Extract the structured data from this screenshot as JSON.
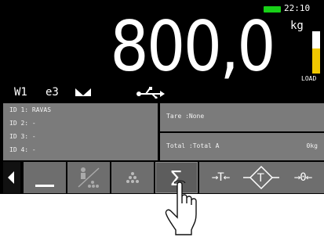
{
  "status_bar": {
    "time": "22:10",
    "battery_color": "#18d018"
  },
  "display": {
    "weight": "800,0",
    "unit": "kg",
    "load_label": "LOAD",
    "load_fraction": 0.6,
    "load_color": "#f0c800"
  },
  "indicators": {
    "scale": "W1",
    "division": "e3",
    "stable_icon": "stable-icon",
    "usb_icon": "usb-icon"
  },
  "ids": [
    {
      "label": "ID 1:",
      "value": "RAVAS"
    },
    {
      "label": "ID 2:",
      "value": "-"
    },
    {
      "label": "ID 3:",
      "value": "-"
    },
    {
      "label": "ID 4:",
      "value": "-"
    }
  ],
  "tare": {
    "label": "Tare",
    "value": ":None"
  },
  "total": {
    "label": "Total",
    "value": ":Total A",
    "amount": "0kg"
  },
  "toolbar": {
    "buttons": [
      {
        "name": "zero-line-button",
        "icon": "underscore-icon",
        "text": ""
      },
      {
        "name": "count-disabled-button",
        "icon": "person-count-icon",
        "text": ""
      },
      {
        "name": "piece-count-button",
        "icon": "pieces-icon",
        "text": ""
      },
      {
        "name": "sum-button",
        "icon": "sigma-icon",
        "text": ""
      },
      {
        "name": "tare-button",
        "icon": "",
        "text": "→T←"
      },
      {
        "name": "preset-tare-button",
        "icon": "preset-tare-icon",
        "text": ""
      },
      {
        "name": "zero-button",
        "icon": "",
        "text": "→0←"
      }
    ]
  }
}
